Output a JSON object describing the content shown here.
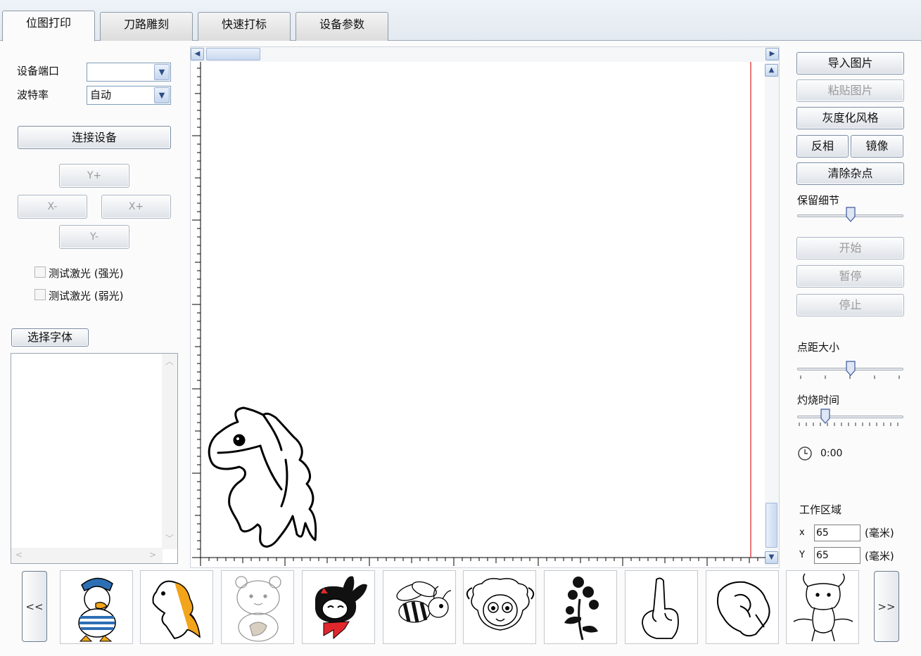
{
  "tabs": [
    "位图打印",
    "刀路雕刻",
    "快速打标",
    "设备参数"
  ],
  "left": {
    "port_label": "设备端口",
    "port_value": "",
    "baud_label": "波特率",
    "baud_value": "自动",
    "connect_button": "连接设备",
    "y_plus": "Y+",
    "x_minus": "X-",
    "x_plus": "X+",
    "y_minus": "Y-",
    "test_strong": "测试激光 (强光)",
    "test_weak": "测试激光 (弱光)",
    "font_button": "选择字体"
  },
  "right": {
    "import_image": "导入图片",
    "paste_image": "粘贴图片",
    "gray_style": "灰度化风格",
    "invert": "反相",
    "mirror": "镜像",
    "clear_noise": "清除杂点",
    "keep_detail_label": "保留细节",
    "keep_detail_level": 0.5,
    "start": "开始",
    "pause": "暂停",
    "stop": "停止",
    "dot_size_label": "点距大小",
    "dot_size_level": 0.5,
    "burn_time_label": "灼烧时间",
    "burn_time_level": 0.24,
    "timer": "0:00",
    "work_area_label": "工作区域",
    "x_label": "x",
    "x_value": "65",
    "y_label": "Y",
    "y_value": "65",
    "unit": "(毫米)"
  },
  "gallery": {
    "prev": "<<",
    "next": ">>",
    "items": [
      "duck-icon",
      "horse-icon",
      "bear-icon",
      "rabbit-icon",
      "bee-icon",
      "sheep-icon",
      "rose-icon",
      "hand-icon",
      "fist-icon",
      "bull-icon"
    ]
  },
  "colors": {
    "red_guide": "#e02020",
    "accent": "#7a8ca3"
  }
}
